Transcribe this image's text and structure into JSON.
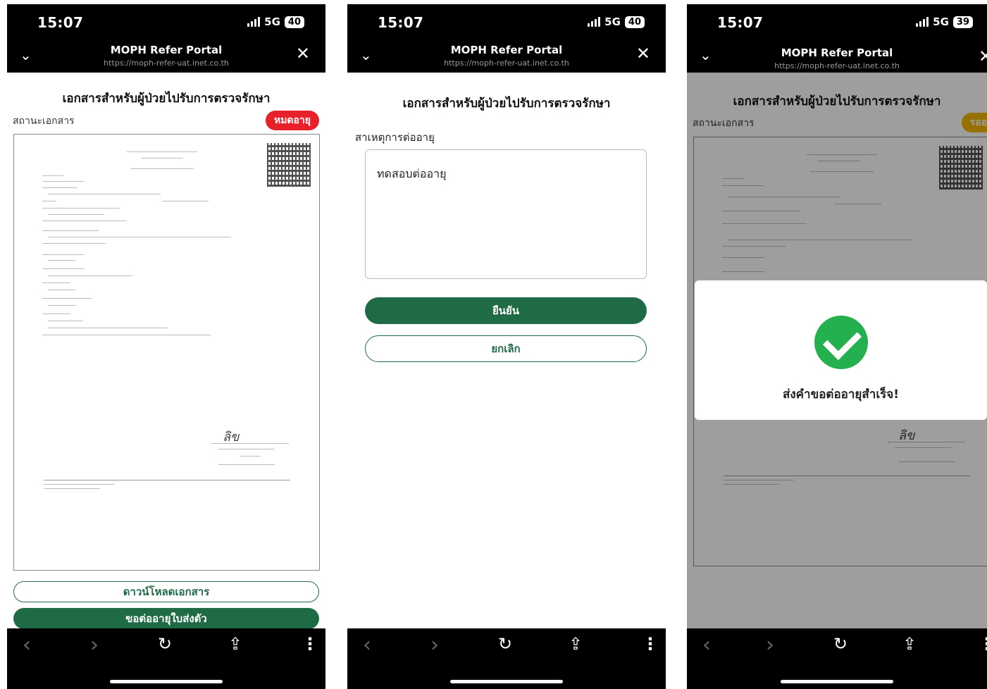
{
  "status_bar": {
    "phone1": {
      "time": "15:07",
      "network": "5G",
      "battery": "40"
    },
    "phone2": {
      "time": "15:07",
      "network": "5G",
      "battery": "40"
    },
    "phone3": {
      "time": "15:07",
      "network": "5G",
      "battery": "39"
    }
  },
  "browser": {
    "title": "MOPH Refer Portal",
    "url": "https://moph-refer-uat.inet.co.th"
  },
  "page": {
    "title": "เอกสารสำหรับผู้ป่วยไปรับการตรวจรักษา",
    "status_label": "สถานะเอกสาร"
  },
  "phone1": {
    "badge": "หมดอายุ",
    "badge_color": "#e8202a",
    "download_button": "ดาวน์โหลดเอกสาร",
    "extend_button": "ขอต่ออายุใบส่งตัว"
  },
  "phone2": {
    "reason_label": "สาเหตุการต่ออายุ",
    "reason_value": "ทดสอบต่ออายุ",
    "confirm_button": "ยืนยัน",
    "cancel_button": "ยกเลิก"
  },
  "phone3": {
    "badge": "รออนุมัติ",
    "badge_color": "#f2b600",
    "success_message": "ส่งคำขอต่ออายุสำเร็จ!"
  },
  "colors": {
    "primary_green": "#1e6b46",
    "success_green": "#24b04f"
  }
}
